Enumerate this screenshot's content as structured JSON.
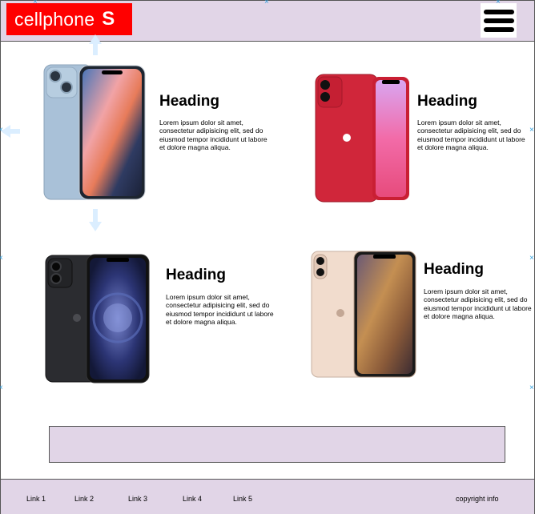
{
  "header": {
    "logo_text": "cellphone",
    "logo_mark": "S",
    "menu_icon": "hamburger-menu-icon"
  },
  "products": [
    {
      "heading": "Heading",
      "text": "Lorem ipsum dolor sit amet, consectetur adipisicing elit, sed do eiusmod tempor incididunt ut labore et dolore magna aliqua.",
      "image": "iphone-14-blue"
    },
    {
      "heading": "Heading",
      "text": "Lorem ipsum dolor sit amet, consectetur adipisicing elit, sed do eiusmod tempor incididunt ut labore et dolore magna aliqua.",
      "image": "iphone-11-red"
    },
    {
      "heading": "Heading",
      "text": "Lorem ipsum dolor sit amet, consectetur adipisicing elit, sed do eiusmod tempor incididunt ut labore et dolore magna aliqua.",
      "image": "iphone-12-black"
    },
    {
      "heading": "Heading",
      "text": "Lorem ipsum dolor sit amet, consectetur adipisicing elit, sed do eiusmod tempor incididunt ut labore et dolore magna aliqua.",
      "image": "iphone-xs-gold"
    }
  ],
  "footer": {
    "links": [
      "Link 1",
      "Link 2",
      "Link 3",
      "Link 4",
      "Link 5"
    ],
    "copyright": "copyright info"
  },
  "colors": {
    "header_bg": "#e1d5e7",
    "logo_bg": "#ff0000",
    "border": "#555555"
  }
}
